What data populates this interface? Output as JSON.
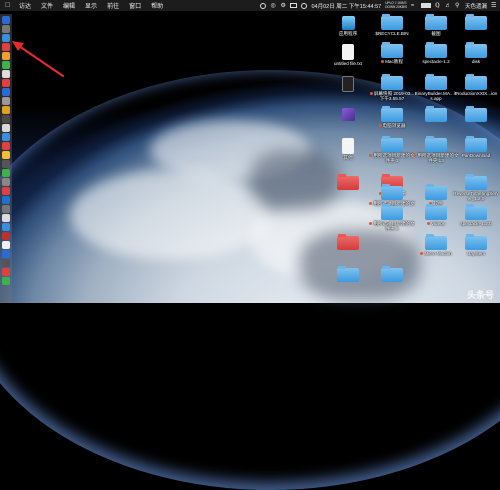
{
  "menubar": {
    "items": [
      "访达",
      "文件",
      "编辑",
      "显示",
      "前往",
      "窗口",
      "帮助"
    ],
    "status": {
      "net_up": "UPLO 7.1KB/S",
      "net_down": "DOWN 20KB/S",
      "clock": "04月02日 周二 下午15:44:57",
      "weather": "天色遗漏"
    }
  },
  "dock": {
    "icon_colors": [
      "#2a6ad8",
      "#777",
      "#3a8ee0",
      "#e04040",
      "#f0a030",
      "#3cb34a",
      "#ddd",
      "#e04040",
      "#2a6ad8",
      "#999",
      "#e0a020",
      "#4a4a4a",
      "#d8d8d8",
      "#3a8ee0",
      "#e04040",
      "#f0c030",
      "#555",
      "#3cb34a",
      "#888",
      "#e04040",
      "#1f70d0",
      "#777",
      "#ddd",
      "#3a8ee0",
      "#c03030",
      "#f0f0f0",
      "#2a6ad8",
      "#555",
      "#e04040",
      "#3cb34a"
    ]
  },
  "desktop": {
    "row1": [
      {
        "label": "应用程序",
        "type": "shield",
        "icon": "app-store-shield-icon"
      },
      {
        "label": "$RECYCLE.BIN",
        "type": "folder",
        "icon": "folder-icon"
      },
      {
        "label": "截图",
        "type": "folder",
        "icon": "folder-icon"
      },
      {
        "label": "",
        "type": "folder",
        "icon": "folder-icon"
      }
    ],
    "row2": [
      {
        "label": "untitled file.txt",
        "type": "doc",
        "icon": "text-file-icon"
      },
      {
        "label": "Mac教程",
        "type": "folder",
        "icon": "folder-icon",
        "dot": "#e05a2a"
      },
      {
        "label": "spectacle-1.2",
        "type": "folder",
        "icon": "folder-icon"
      },
      {
        "label": "disk",
        "type": "folder",
        "icon": "folder-icon"
      }
    ],
    "row3": [
      {
        "label": "",
        "type": "doc-dark",
        "icon": "terminal-file-icon"
      },
      {
        "label": "屏幕快照 2019-03... 下午3.55.57",
        "type": "folder",
        "icon": "folder-icon",
        "dot": "#e05a2a"
      },
      {
        "label": "BinaryBuilder.MA...ios.app",
        "type": "folder",
        "icon": "folder-icon"
      },
      {
        "label": "ProductionXXtX...ion",
        "type": "folder",
        "icon": "folder-icon"
      }
    ],
    "row4": [
      {
        "label": "",
        "type": "app-purple",
        "icon": "app-icon"
      },
      {
        "label": "电脑浏览器",
        "type": "folder",
        "icon": "folder-icon",
        "dot": "#e05a2a"
      },
      {
        "label": "",
        "type": "folder",
        "icon": "folder-icon"
      },
      {
        "label": "",
        "type": "folder",
        "icon": "folder-icon"
      }
    ],
    "row5": [
      {
        "label": "其他",
        "type": "doc",
        "icon": "document-icon"
      },
      {
        "label": "用所选项目新建的文件夹 3",
        "type": "folder",
        "icon": "folder-icon",
        "dot": "#e05a2a"
      },
      {
        "label": "用所选项目新建的文件夹 13",
        "type": "folder",
        "icon": "folder-icon",
        "dot": "#e05a2a"
      },
      {
        "label": "PanDownload",
        "type": "folder",
        "icon": "folder-icon"
      }
    ],
    "row6": [
      {
        "label": "",
        "type": "folder-red",
        "icon": "red-folder-icon"
      },
      {
        "label": "新建文件夹",
        "type": "folder-red",
        "icon": "red-folder-icon",
        "dot": "#e05a2a"
      },
      {
        "label": "ReverseTotheringServer_1.2.0",
        "type": "folder",
        "icon": "folder-icon"
      }
    ],
    "row6b": [
      {
        "label": "用所选项目新建的文件夹 8",
        "type": "folder",
        "icon": "folder-icon",
        "dot": "#e05a2a"
      },
      {
        "label": "软件",
        "type": "folder",
        "icon": "folder-icon",
        "dot": "#e05a2a"
      }
    ],
    "row7": [
      {
        "label": "用所选项目新建的文件夹 5",
        "type": "folder",
        "icon": "folder-icon",
        "dot": "#e05a2a"
      },
      {
        "label": "Videos",
        "type": "folder",
        "icon": "folder-icon",
        "dot": "#e05a2a"
      },
      {
        "label": "spectacle-1.2.0",
        "type": "folder",
        "icon": "folder-icon"
      }
    ],
    "row8": [
      {
        "label": "",
        "type": "folder-red",
        "icon": "red-folder-icon"
      },
      {
        "label": "Micro Machin",
        "type": "folder",
        "icon": "folder-icon",
        "dot": "#e05a2a"
      },
      {
        "label": "Uaystem",
        "type": "folder",
        "icon": "folder-icon"
      }
    ],
    "row9": [
      {
        "label": "",
        "type": "folder",
        "icon": "folder-icon"
      },
      {
        "label": "",
        "type": "folder",
        "icon": "folder-icon"
      }
    ]
  },
  "watermark": "头条号"
}
